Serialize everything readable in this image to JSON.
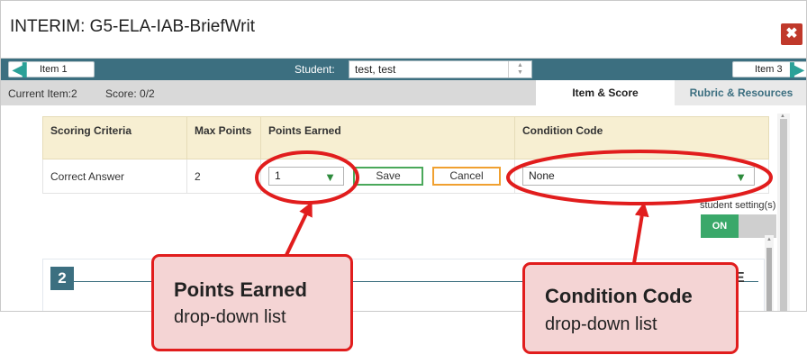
{
  "window": {
    "title": "INTERIM: G5-ELA-IAB-BriefWrit",
    "close_glyph": "✖",
    "close_icon": "close-icon"
  },
  "nav": {
    "prev_label": "Item 1",
    "next_label": "Item 3",
    "prev_icon": "double-chevron-left-icon",
    "next_icon": "double-chevron-right-icon",
    "prev_glyph": "◀▌",
    "next_glyph": "▐▶",
    "student_label": "Student:",
    "student_value": "test, test"
  },
  "info": {
    "current_item": "Current Item:2",
    "score": "Score: 0/2"
  },
  "tabs": [
    {
      "label": "Item & Score",
      "active": true
    },
    {
      "label": "Rubric & Resources",
      "active": false
    }
  ],
  "table": {
    "headers": {
      "criteria": "Scoring Criteria",
      "max_points": "Max Points",
      "points_earned": "Points Earned",
      "condition_code": "Condition Code"
    },
    "row": {
      "criteria": "Correct Answer",
      "max_points": "2",
      "points_earned_value": "1",
      "save_label": "Save",
      "cancel_label": "Cancel",
      "condition_code_value": "None"
    }
  },
  "student_setting": {
    "label": "student setting(s)",
    "toggle_label": "ON"
  },
  "item_panel": {
    "number": "2",
    "trailing_text": "E"
  },
  "annotations": {
    "points": {
      "title": "Points Earned",
      "subtitle": "drop-down list"
    },
    "condition": {
      "title": "Condition Code",
      "subtitle": "drop-down list"
    }
  },
  "colors": {
    "accent_teal": "#3c6f80",
    "header_beige": "#f7efd2",
    "callout_red": "#e11d1d",
    "callout_fill": "#f4d4d4",
    "save_green": "#4aa85a",
    "cancel_orange": "#f0a030",
    "toggle_green": "#3aa86a",
    "close_red": "#c0392b"
  }
}
